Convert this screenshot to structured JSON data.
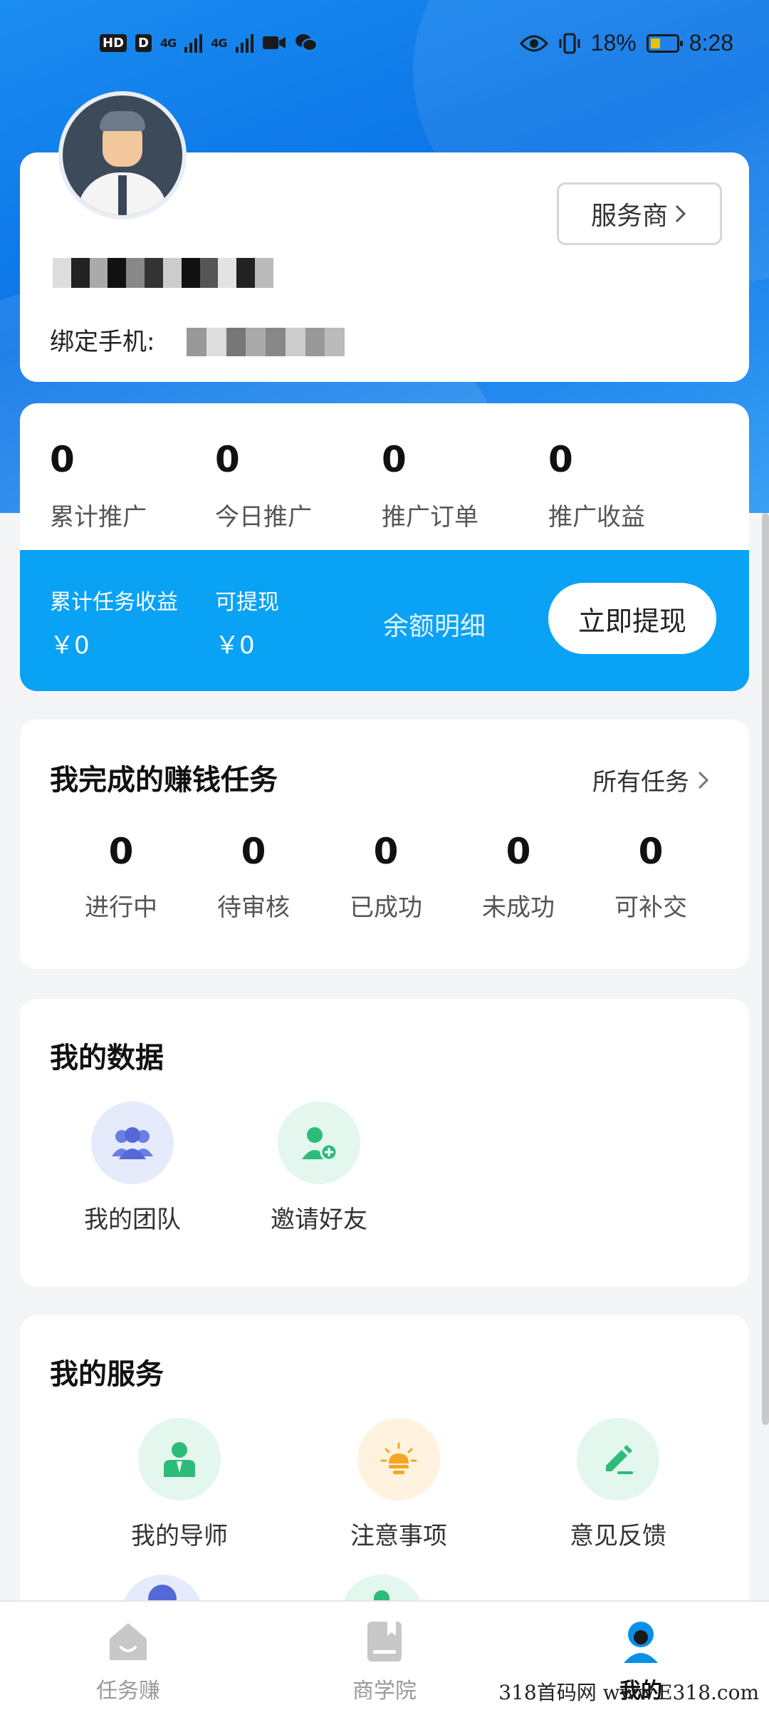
{
  "status_bar": {
    "left_chips": [
      "HD",
      "D"
    ],
    "network_1": "4G",
    "network_2": "4G",
    "battery_pct": "18%",
    "time": "8:28"
  },
  "profile": {
    "provider_button": "服务商",
    "phone_label": "绑定手机:"
  },
  "stats": {
    "items": [
      {
        "value": "0",
        "label": "累计推广"
      },
      {
        "value": "0",
        "label": "今日推广"
      },
      {
        "value": "0",
        "label": "推广订单"
      },
      {
        "value": "0",
        "label": "推广收益"
      }
    ],
    "task_income_label": "累计任务收益",
    "task_income_value": "￥0",
    "withdrawable_label": "可提现",
    "withdrawable_value": "￥0",
    "balance_detail": "余额明细",
    "withdraw_button": "立即提现"
  },
  "tasks": {
    "title": "我完成的赚钱任务",
    "all_link": "所有任务",
    "items": [
      {
        "value": "0",
        "label": "进行中"
      },
      {
        "value": "0",
        "label": "待审核"
      },
      {
        "value": "0",
        "label": "已成功"
      },
      {
        "value": "0",
        "label": "未成功"
      },
      {
        "value": "0",
        "label": "可补交"
      }
    ]
  },
  "my_data": {
    "title": "我的数据",
    "items": [
      {
        "label": "我的团队",
        "icon": "team-icon"
      },
      {
        "label": "邀请好友",
        "icon": "invite-friend-icon"
      }
    ]
  },
  "my_services": {
    "title": "我的服务",
    "items": [
      {
        "label": "我的导师",
        "icon": "mentor-icon"
      },
      {
        "label": "注意事项",
        "icon": "lightbulb-icon"
      },
      {
        "label": "意见反馈",
        "icon": "feedback-edit-icon"
      }
    ]
  },
  "bottom_nav": {
    "items": [
      {
        "label": "任务赚",
        "icon": "home-icon",
        "active": false
      },
      {
        "label": "商学院",
        "icon": "book-icon",
        "active": false
      },
      {
        "label": "我的",
        "icon": "profile-icon",
        "active": true
      }
    ]
  },
  "watermark": "318首码网 www.E318.com",
  "colors": {
    "primary_blue": "#0aa2f5",
    "header_blue": "#1b8cf0",
    "team_icon_bg": "#e6ebfb",
    "green_icon_bg": "#e3f7ee",
    "orange_icon_bg": "#fff3e0"
  }
}
